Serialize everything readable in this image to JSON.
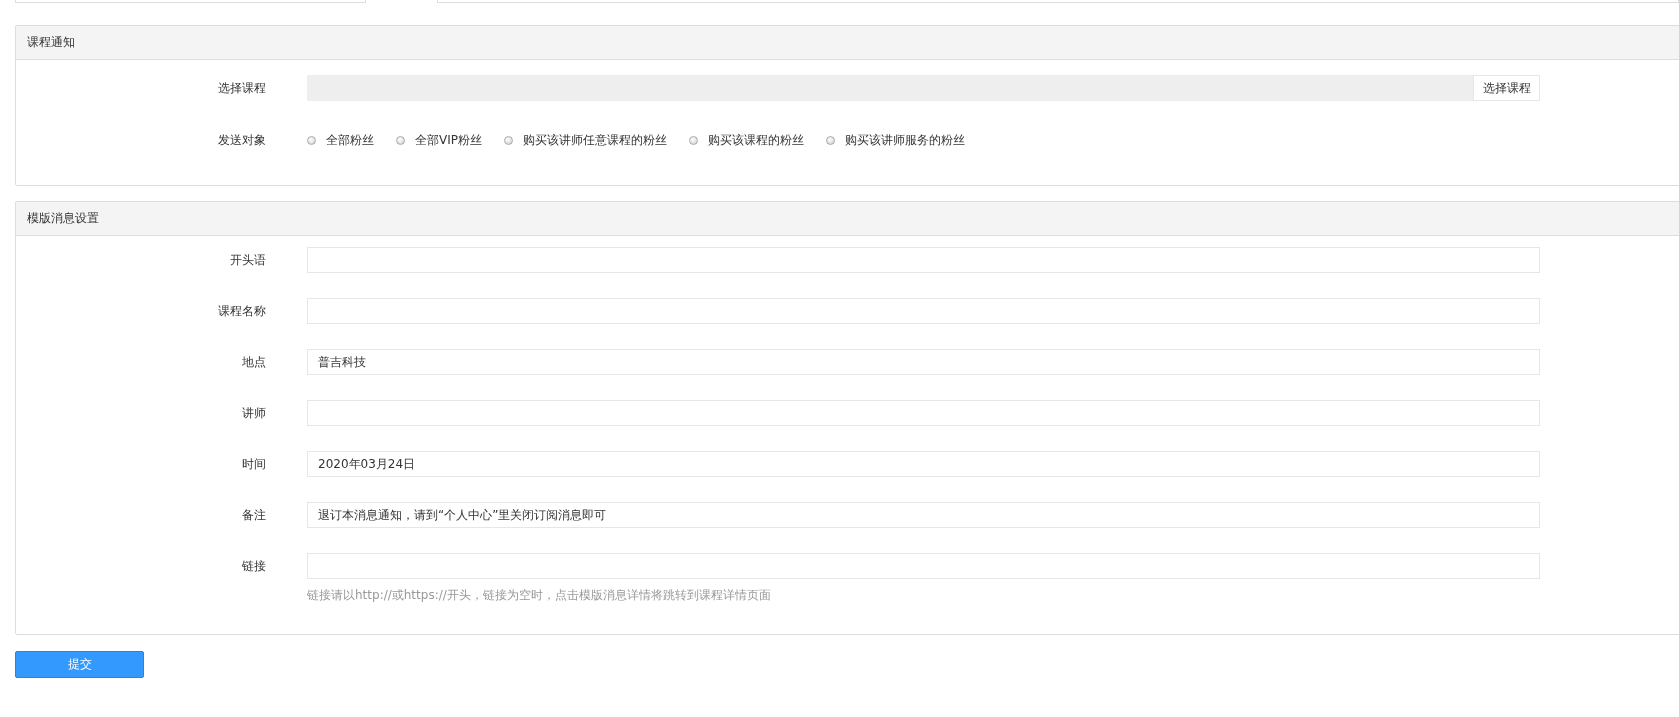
{
  "top_fields": [
    {
      "kind": "input"
    },
    {
      "kind": "input"
    }
  ],
  "course_notice": {
    "title": "课程通知",
    "select_course": {
      "label": "选择课程",
      "button": "选择课程"
    },
    "audience": {
      "label": "发送对象",
      "options": [
        {
          "label": "全部粉丝",
          "selected": false
        },
        {
          "label": "全部VIP粉丝",
          "selected": false
        },
        {
          "label": "购买该讲师任意课程的粉丝",
          "selected": false
        },
        {
          "label": "购买该课程的粉丝",
          "selected": false
        },
        {
          "label": "购买该讲师服务的粉丝",
          "selected": false
        }
      ]
    }
  },
  "template_settings": {
    "title": "模版消息设置",
    "fields": [
      {
        "label": "开头语"
      },
      {
        "label": "课程名称"
      },
      {
        "label": "地点",
        "value": "普吉科技"
      },
      {
        "label": "讲师"
      },
      {
        "label": "时间",
        "value": "2020年03月24日"
      },
      {
        "label": "备注",
        "value": "退订本消息通知，请到“个人中心”里关闭订阅消息即可"
      },
      {
        "label": "链接",
        "hint": "链接请以http://或https://开头，链接为空时，点击模版消息详情将跳转到课程详情页面"
      }
    ]
  },
  "submit": "提交"
}
